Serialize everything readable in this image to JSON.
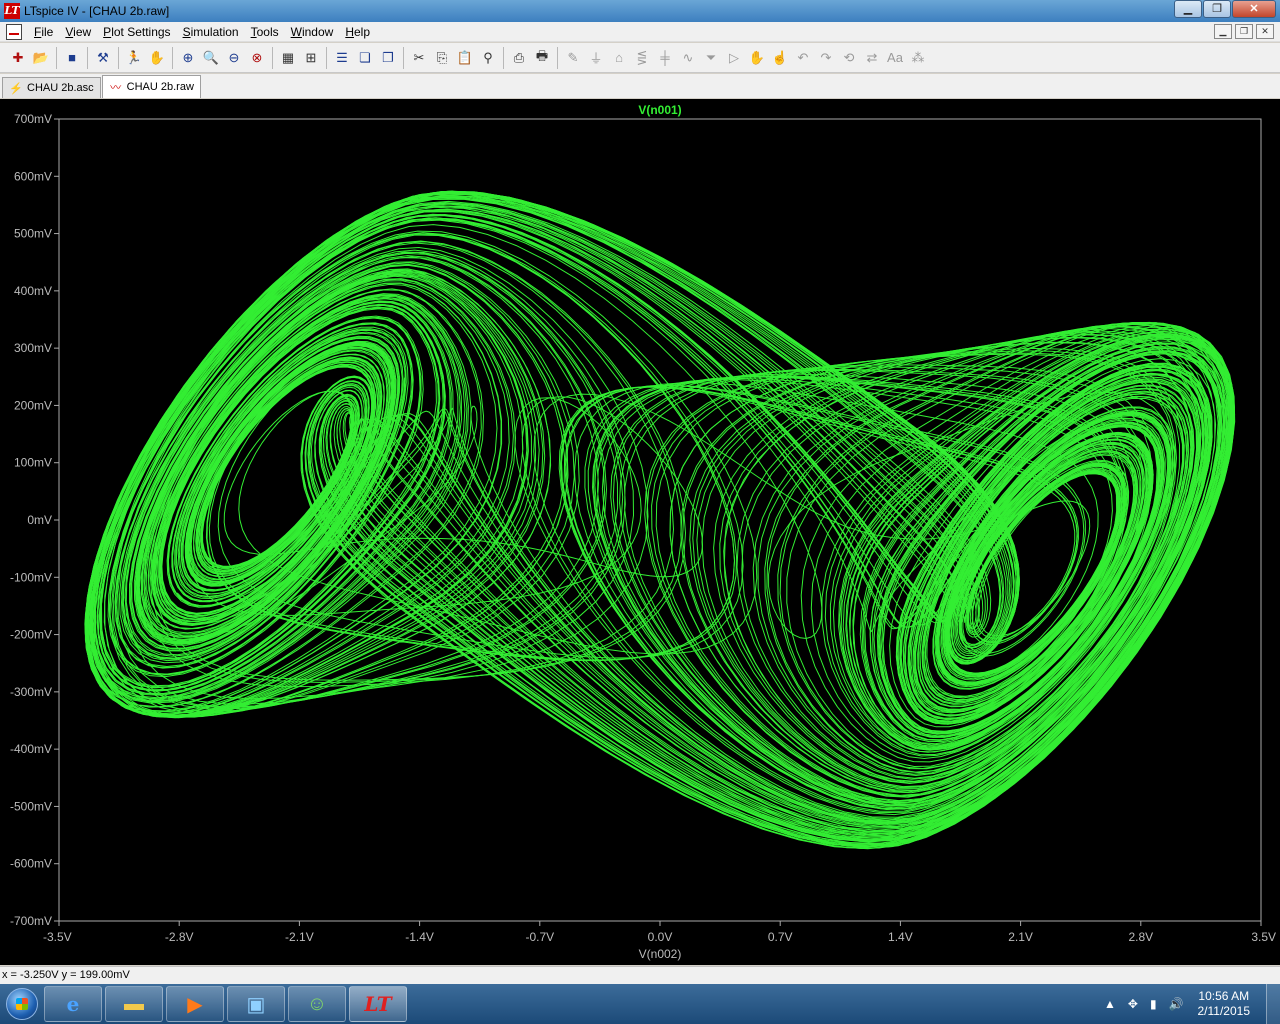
{
  "window": {
    "title": "LTspice IV - [CHAU 2b.raw]",
    "app_icon_glyph": "LT",
    "minimize_glyph": "▁",
    "maximize_glyph": "❐",
    "close_glyph": "✕"
  },
  "menu": {
    "items": [
      "File",
      "View",
      "Plot Settings",
      "Simulation",
      "Tools",
      "Window",
      "Help"
    ],
    "mdi_minimize": "▁",
    "mdi_restore": "❐",
    "mdi_close": "✕"
  },
  "toolbar": {
    "icons": [
      "new-schematic-icon",
      "open-icon",
      "save-icon",
      "control-panel-icon",
      "run-icon",
      "halt-icon",
      "zoom-in-icon",
      "zoom-box-icon",
      "zoom-out-icon",
      "zoom-cancel-icon",
      "autorange-icon",
      "pick-visible-traces-icon",
      "tile-horizontal-icon",
      "cascade-icon",
      "close-all-icon",
      "cut-icon",
      "copy-icon",
      "paste-icon",
      "find-icon",
      "print-preview-icon",
      "print-icon",
      "wire-icon",
      "ground-icon",
      "label-icon",
      "resistor-icon",
      "capacitor-icon",
      "inductor-icon",
      "diode-icon",
      "component-icon",
      "move-icon",
      "drag-icon",
      "undo-icon",
      "redo-icon",
      "rotate-icon",
      "mirror-icon",
      "text-icon",
      "spice-directive-icon"
    ]
  },
  "tabs": [
    {
      "label": "CHAU 2b.asc",
      "active": false
    },
    {
      "label": "CHAU 2b.raw",
      "active": true
    }
  ],
  "plot": {
    "trace_name": "V(n001)",
    "x_axis_label": "V(n002)",
    "trace_color": "#33ee33",
    "axis_color": "#aaaaaa",
    "x_ticks": [
      "-3.5V",
      "-2.8V",
      "-2.1V",
      "-1.4V",
      "-0.7V",
      "0.0V",
      "0.7V",
      "1.4V",
      "2.1V",
      "2.8V",
      "3.5V"
    ],
    "y_ticks": [
      "700mV",
      "600mV",
      "500mV",
      "400mV",
      "300mV",
      "200mV",
      "100mV",
      "0mV",
      "-100mV",
      "-200mV",
      "-300mV",
      "-400mV",
      "-500mV",
      "-600mV",
      "-700mV"
    ],
    "x_range": [
      -3.5,
      3.5
    ],
    "y_range": [
      -0.7,
      0.7
    ]
  },
  "status": {
    "cursor_readout": "x = -3.250V    y = 199.00mV"
  },
  "taskbar": {
    "apps": [
      "ie-icon",
      "explorer-icon",
      "media-player-icon",
      "remote-desktop-icon",
      "messenger-icon",
      "ltspice-icon"
    ],
    "clock_time": "10:56 AM",
    "clock_date": "2/11/2015"
  }
}
